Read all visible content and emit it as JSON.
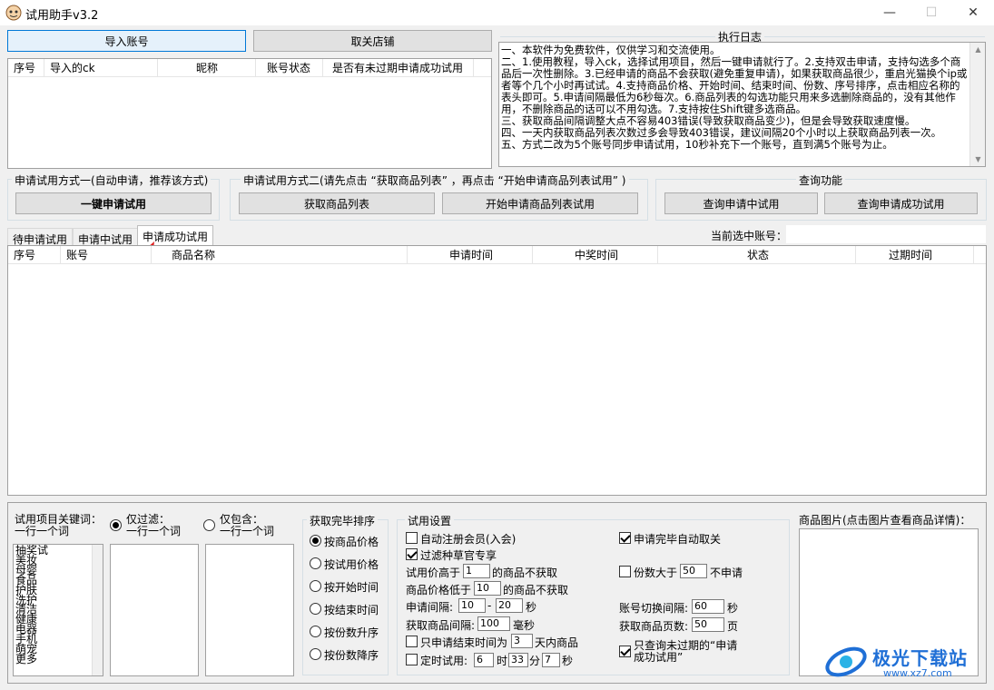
{
  "window": {
    "title": "试用助手v3.2",
    "minimize": "—",
    "maximize": "☐",
    "close": "✕"
  },
  "top_buttons": {
    "import": "导入账号",
    "unfollow": "取关店铺"
  },
  "accounts_table": {
    "columns": [
      "序号",
      "导入的ck",
      "昵称",
      "账号状态",
      "是否有未过期申请成功试用"
    ]
  },
  "log": {
    "title": "执行日志",
    "text": "一、本软件为免费软件，仅供学习和交流使用。\n二、1.使用教程，导入ck，选择试用项目，然后一键申请就行了。2.支持双击申请，支持勾选多个商品后一次性删除。3.已经申请的商品不会获取(避免重复申请)，如果获取商品很少，重启光猫换个ip或者等个几个小时再试试。4.支持商品价格、开始时间、结束时间、份数、序号排序，点击相应名称的表头即可。5.申请间隔最低为6秒每次。6.商品列表的勾选功能只用来多选删除商品的，没有其他作用，不删除商品的话可以不用勾选。7.支持按住Shift键多选商品。\n三、获取商品间隔调整大点不容易403错误(导致获取商品变少)，但是会导致获取速度慢。\n四、一天内获取商品列表次数过多会导致403错误，建议间隔20个小时以上获取商品列表一次。\n五、方式二改为5个账号同步申请试用，10秒补充下一个账号，直到满5个账号为止。"
  },
  "mode1": {
    "title": "申请试用方式一(自动申请，推荐该方式)",
    "button": "一键申请试用"
  },
  "mode2": {
    "title": "申请试用方式二(请先点击 “获取商品列表” ，再点击 “开始申请商品列表试用” )",
    "get_list": "获取商品列表",
    "start": "开始申请商品列表试用"
  },
  "query": {
    "title": "查询功能",
    "applying": "查询申请中试用",
    "success": "查询申请成功试用"
  },
  "tabs": [
    {
      "label": "待申请试用"
    },
    {
      "label": "申请中试用"
    },
    {
      "label": "申请成功试用"
    }
  ],
  "current_account_label": "当前选中账号：",
  "result_table": {
    "columns": [
      "序号",
      "账号",
      "商品名称",
      "申请时间",
      "中奖时间",
      "状态",
      "过期时间"
    ]
  },
  "filter": {
    "title": "试用项目关键词：\n一行一个词",
    "only_filter": "仅过滤：\n一行一个词",
    "only_include": "仅包含：\n一行一个词",
    "keywords": [
      "抽奖试",
      "美妆",
      "母婴",
      "食品",
      "护肤",
      "洗护",
      "清洁",
      "健康",
      "电器",
      "手机",
      "萌宠",
      "更多"
    ]
  },
  "sort": {
    "title": "获取完毕排序",
    "options": [
      "按商品价格",
      "按试用价格",
      "按开始时间",
      "按结束时间",
      "按份数升序",
      "按份数降序"
    ],
    "selected": "按商品价格"
  },
  "settings": {
    "title": "试用设置",
    "auto_register": "自动注册会员(入会)",
    "filter_seed": "过滤种草官专享",
    "price_high_prefix": "试用价高于",
    "price_high_value": "1",
    "price_high_suffix": "的商品不获取",
    "price_low_prefix": "商品价格低于",
    "price_low_value": "10",
    "price_low_suffix": "的商品不获取",
    "interval_label": "申请间隔:",
    "interval_min": "10",
    "interval_dash": "-",
    "interval_max": "20",
    "interval_unit": "秒",
    "fetch_interval_label": "获取商品间隔:",
    "fetch_interval_value": "100",
    "fetch_interval_unit": "毫秒",
    "end_within_prefix": "只申请结束时间为",
    "end_within_value": "3",
    "end_within_suffix": "天内商品",
    "timed_label": "定时试用:",
    "timed_h": "6",
    "timed_h_unit": "时",
    "timed_m": "33",
    "timed_m_unit": "分",
    "timed_s": "7",
    "timed_s_unit": "秒",
    "auto_unfollow": "申请完毕自动取关",
    "copies_prefix": "份数大于",
    "copies_value": "50",
    "copies_suffix": "不申请",
    "switch_label": "账号切换间隔:",
    "switch_value": "60",
    "switch_unit": "秒",
    "pages_label": "获取商品页数:",
    "pages_value": "50",
    "pages_unit": "页",
    "only_unexpired": "只查询未过期的“申请\n成功试用”"
  },
  "product_image": {
    "title": "商品图片(点击图片查看商品详情)："
  },
  "watermark": {
    "text": "极光下载站",
    "url": "www.xz7.com"
  },
  "colors": {
    "accent": "#0078d7",
    "arrow": "#e02020",
    "watermark_blue": "#1f6fd6"
  }
}
